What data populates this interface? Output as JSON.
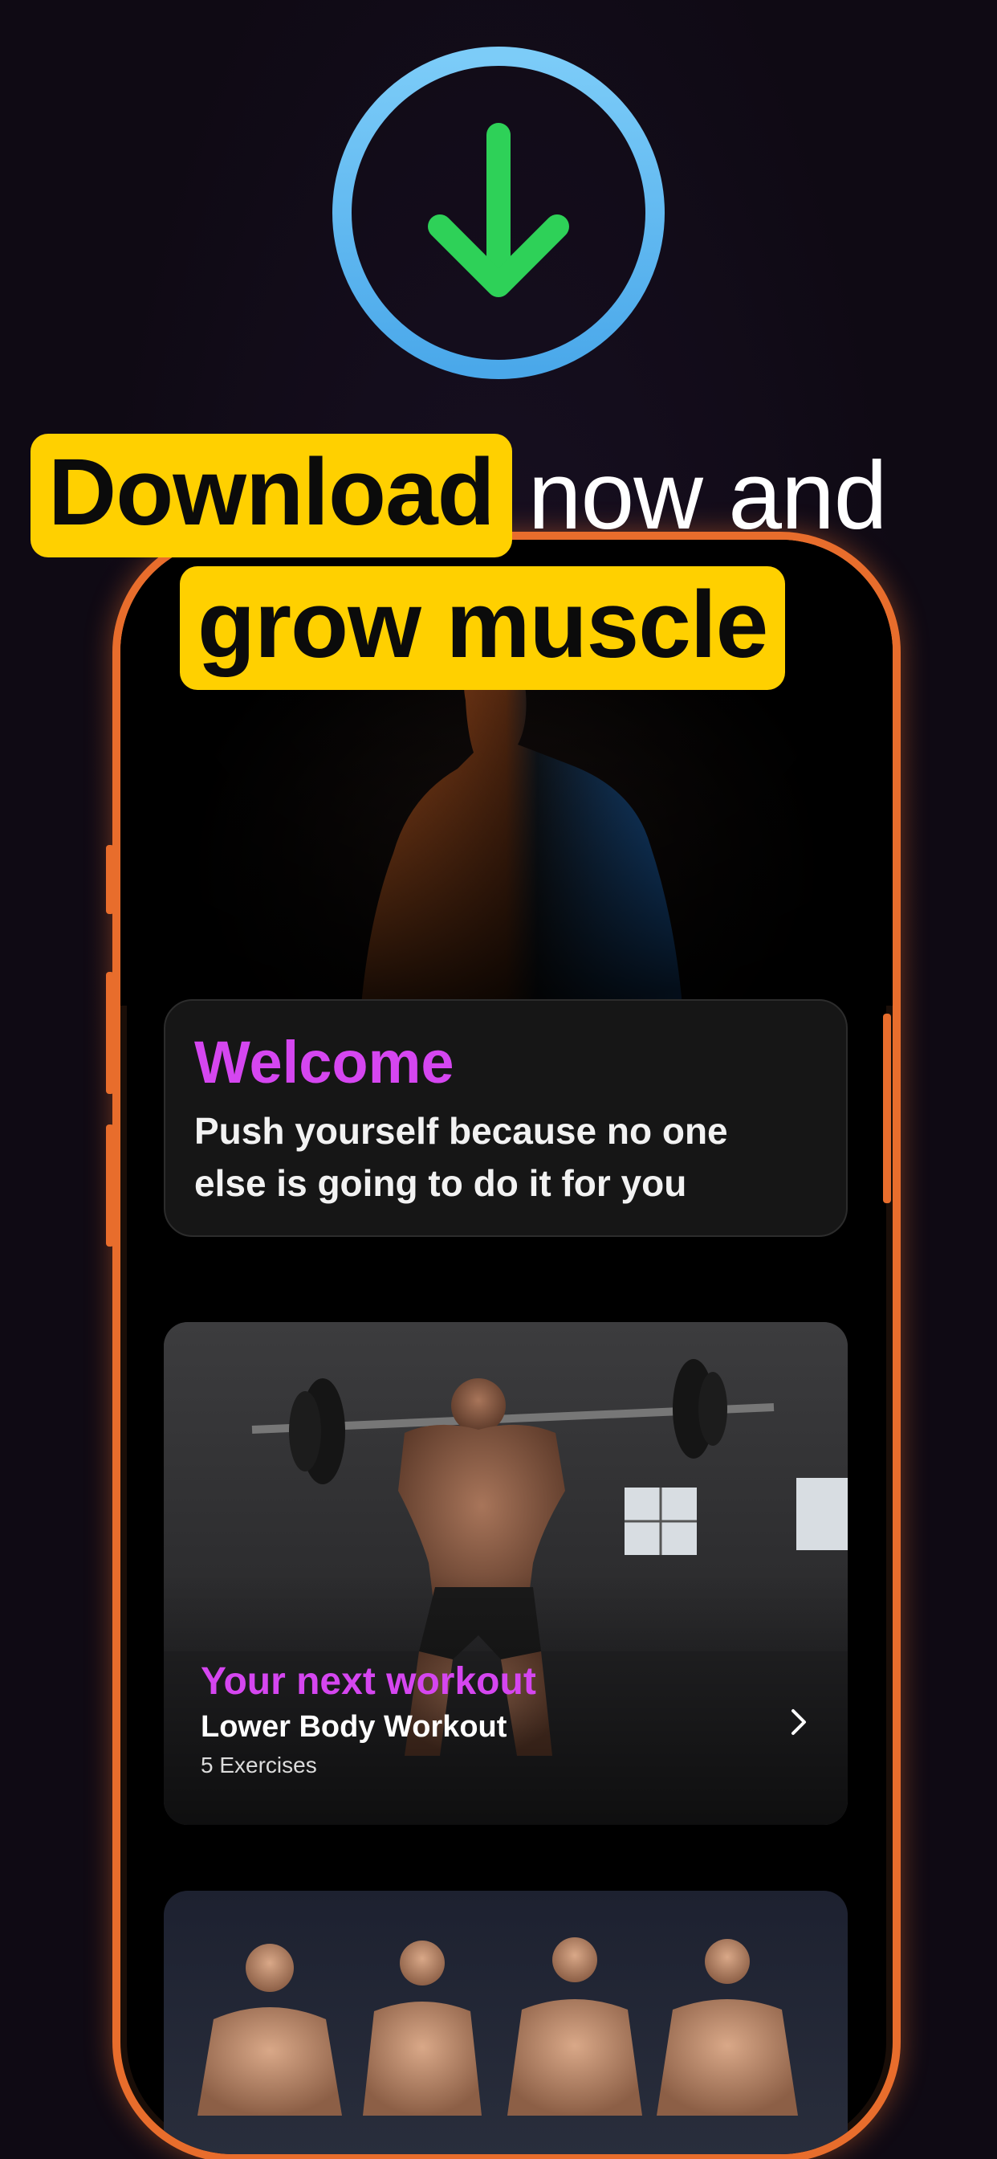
{
  "headline": {
    "highlight_1": "Download",
    "plain_1": "now and",
    "highlight_2": "grow muscle"
  },
  "welcome": {
    "title": "Welcome",
    "subtitle": "Push yourself because no one else is going to do it for you"
  },
  "workout": {
    "label": "Your next workout",
    "name": "Lower Body Workout",
    "count": "5 Exercises"
  },
  "colors": {
    "accent_purple": "#d546f0",
    "highlight_yellow": "#ffd000",
    "phone_frame_orange": "#e86d2c",
    "download_ring_blue": "#5ab8f2",
    "download_arrow_green": "#2ed158"
  },
  "icons": {
    "download": "download-arrow-circle-icon",
    "chevron": "chevron-right-icon"
  }
}
